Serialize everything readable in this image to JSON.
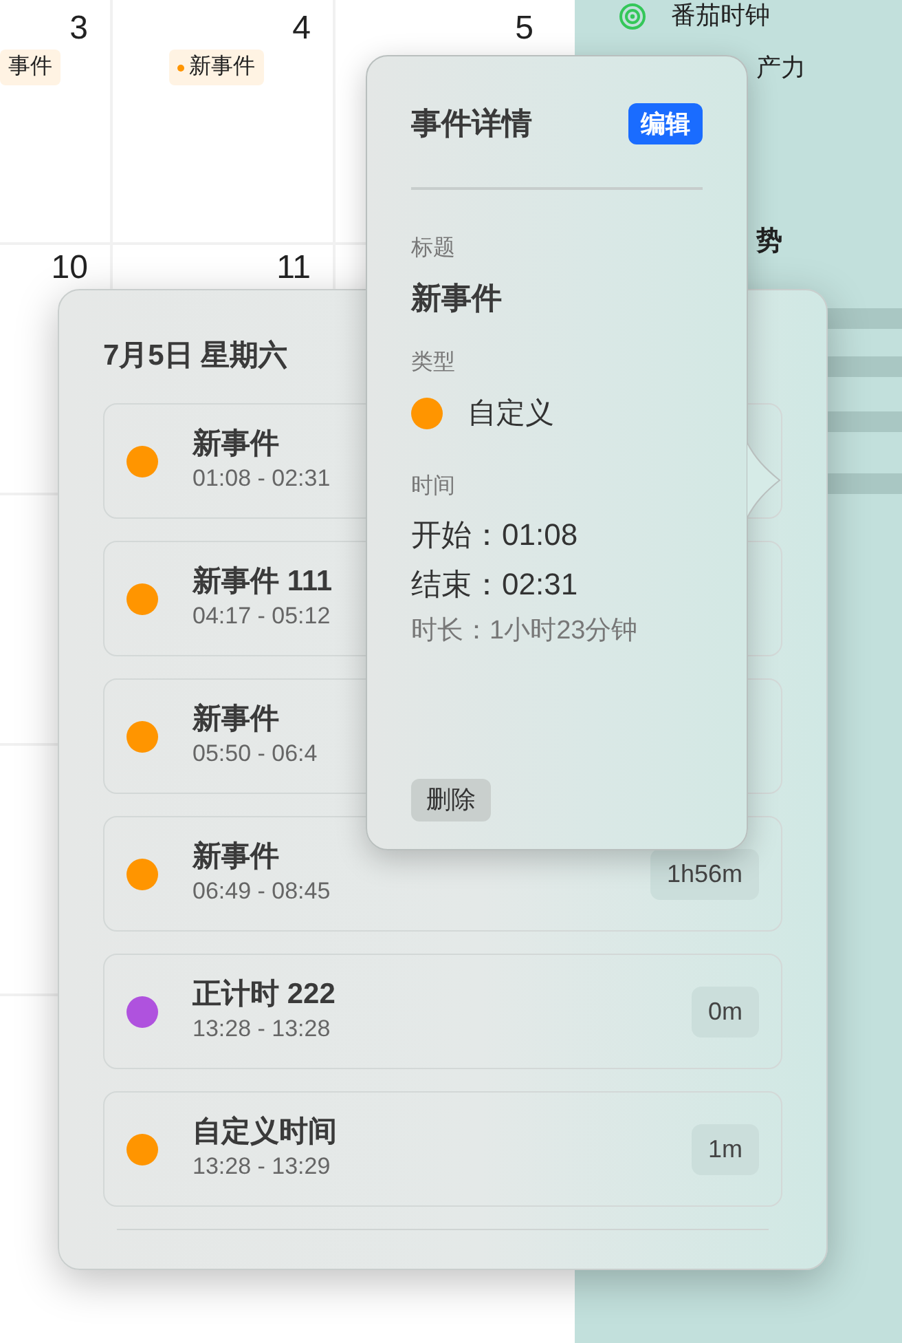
{
  "calendar": {
    "rows": [
      {
        "cells": [
          {
            "day": "3",
            "events": [
              {
                "title": "事件"
              }
            ]
          },
          {
            "day": "4",
            "events": [
              {
                "title": "新事件",
                "color": "#ff9500"
              }
            ]
          },
          {
            "day": "5"
          }
        ]
      },
      {
        "cells": [
          {
            "day": "10"
          },
          {
            "day": "11"
          },
          {}
        ]
      },
      {
        "cells": [
          {},
          {},
          {}
        ]
      },
      {
        "cells": [
          {},
          {},
          {}
        ]
      },
      {
        "cells": [
          {},
          {},
          {}
        ]
      }
    ]
  },
  "sidebar": {
    "items": [
      {
        "label": "番茄时钟",
        "kind": "target"
      },
      {
        "label": "产力",
        "kind": "plain"
      }
    ],
    "heading": "势"
  },
  "day_popover": {
    "title": "7月5日 星期六",
    "events": [
      {
        "title": "新事件",
        "time": "01:08 - 02:31",
        "color": "#ff9500"
      },
      {
        "title": "新事件 111",
        "time": "04:17 - 05:12",
        "color": "#ff9500"
      },
      {
        "title": "新事件",
        "time": "05:50 - 06:4",
        "color": "#ff9500"
      },
      {
        "title": "新事件",
        "time": "06:49 - 08:45",
        "color": "#ff9500",
        "duration": "1h56m"
      },
      {
        "title": "正计时 222",
        "time": "13:28 - 13:28",
        "color": "#af52de",
        "duration": "0m"
      },
      {
        "title": "自定义时间",
        "time": "13:28 - 13:29",
        "color": "#ff9500",
        "duration": "1m"
      }
    ]
  },
  "detail_popover": {
    "title": "事件详情",
    "edit_button": "编辑",
    "title_label": "标题",
    "event_title": "新事件",
    "type_label": "类型",
    "type": {
      "label": "自定义",
      "color": "#ff9500"
    },
    "time_label": "时间",
    "start": "开始：01:08",
    "end": "结束：02:31",
    "duration": "时长：1小时23分钟",
    "delete_button": "删除"
  }
}
